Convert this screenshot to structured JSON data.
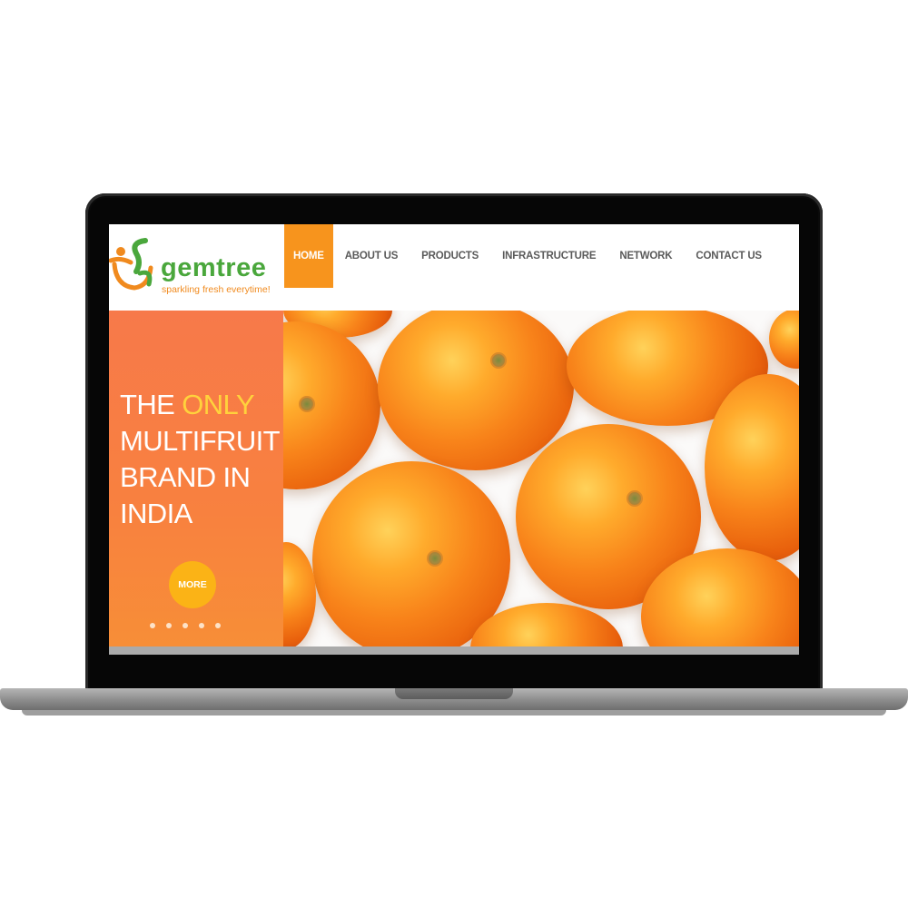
{
  "brand": {
    "name": "gemtree",
    "tagline": "sparkling fresh everytime!",
    "colors": {
      "green": "#4aa73c",
      "orange": "#f7941d",
      "accent_yellow": "#ffd23c"
    }
  },
  "nav": {
    "items": [
      {
        "label": "HOME",
        "active": true
      },
      {
        "label": "ABOUT US",
        "active": false
      },
      {
        "label": "PRODUCTS",
        "active": false
      },
      {
        "label": "INFRASTRUCTURE",
        "active": false
      },
      {
        "label": "NETWORK",
        "active": false
      },
      {
        "label": "CONTACT US",
        "active": false
      }
    ]
  },
  "hero": {
    "heading_part1": "THE ",
    "heading_highlight": "ONLY",
    "heading_part2": " MULTIFRUIT BRAND IN INDIA",
    "more_label": "MORE",
    "slide_count": 5,
    "image_subject": "oranges"
  }
}
